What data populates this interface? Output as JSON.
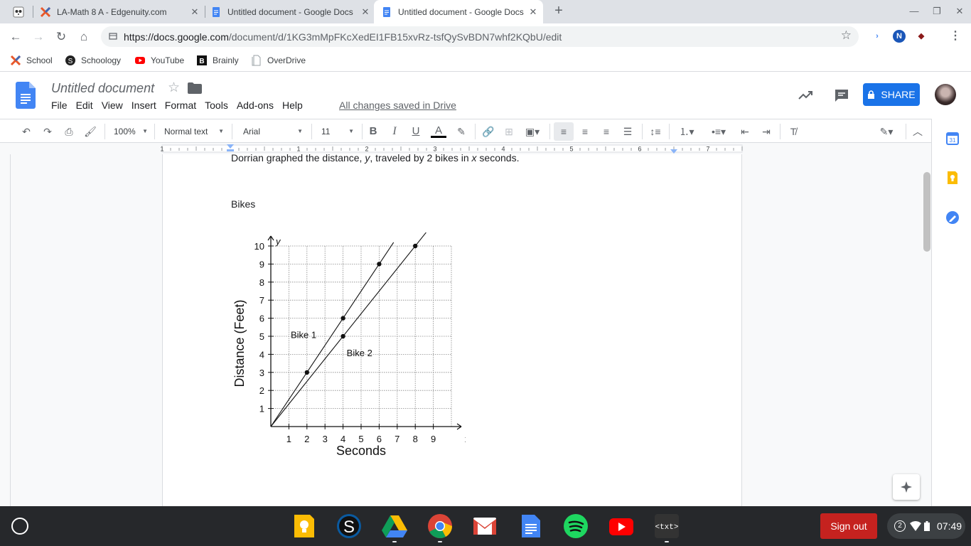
{
  "browser": {
    "tabs": [
      {
        "title": ""
      },
      {
        "title": "LA-Math 8 A - Edgenuity.com"
      },
      {
        "title": "Untitled document - Google Docs"
      },
      {
        "title": "Untitled document - Google Docs"
      }
    ],
    "url_host": "https://docs.google.com",
    "url_path": "/document/d/1KG3mMpFKcXedEI1FB15xvRz-tsfQySvBDN7whf2KQbU/edit",
    "bookmarks": [
      "School",
      "Schoology",
      "YouTube",
      "Brainly",
      "OverDrive"
    ]
  },
  "docs": {
    "title": "Untitled document",
    "menu": [
      "File",
      "Edit",
      "View",
      "Insert",
      "Format",
      "Tools",
      "Add-ons",
      "Help"
    ],
    "saved_status": "All changes saved in Drive",
    "share_label": "SHARE",
    "toolbar": {
      "zoom": "100%",
      "style": "Normal text",
      "font": "Arial",
      "size": "11"
    },
    "ruler_numbers": [
      "1",
      "1",
      "2",
      "3",
      "4",
      "5",
      "6",
      "7"
    ]
  },
  "document": {
    "paragraph1_a": "Dorrian graphed the distance, ",
    "paragraph1_var_y": "y",
    "paragraph1_b": ", traveled by 2 bikes in ",
    "paragraph1_var_x": "x",
    "paragraph1_c": " seconds.",
    "heading": "Bikes"
  },
  "chart_data": {
    "type": "line",
    "title": "",
    "xlabel": "Seconds",
    "ylabel": "Distance (Feet)",
    "x_axis_symbol": "x",
    "y_axis_symbol": "y",
    "xlim": [
      0,
      10
    ],
    "ylim": [
      0,
      10
    ],
    "xticks": [
      1,
      2,
      3,
      4,
      5,
      6,
      7,
      8,
      9
    ],
    "yticks": [
      1,
      2,
      3,
      4,
      5,
      6,
      7,
      8,
      9,
      10
    ],
    "grid": true,
    "series": [
      {
        "name": "Bike 1",
        "points": [
          [
            0,
            0
          ],
          [
            2,
            3
          ],
          [
            4,
            6
          ],
          [
            6,
            9
          ]
        ],
        "line_end_x": 6.8
      },
      {
        "name": "Bike 2",
        "points": [
          [
            0,
            0
          ],
          [
            4,
            5
          ],
          [
            8,
            10
          ]
        ],
        "line_end_x": 8.6
      }
    ]
  },
  "shelf": {
    "signout_label": "Sign out",
    "notification_count": "2",
    "clock": "07:49"
  }
}
